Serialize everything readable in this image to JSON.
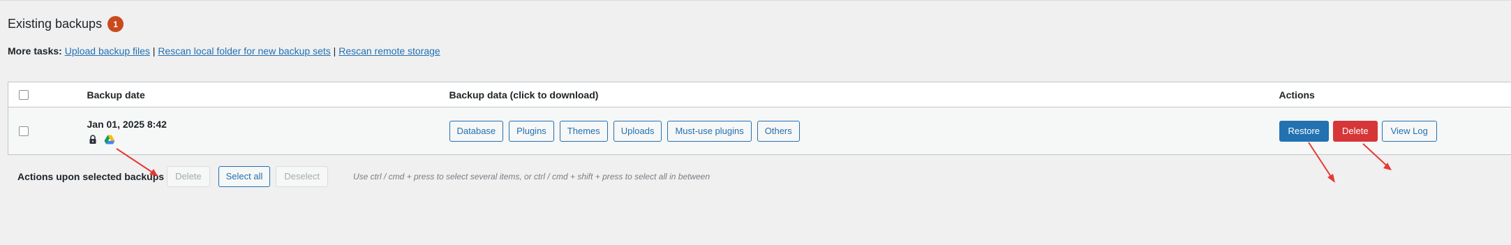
{
  "header": {
    "title": "Existing backups",
    "count_badge": "1"
  },
  "more_tasks": {
    "label": "More tasks:",
    "links": [
      "Upload backup files",
      "Rescan local folder for new backup sets",
      "Rescan remote storage"
    ],
    "separator": "|"
  },
  "table": {
    "columns": [
      "",
      "Backup date",
      "Backup data (click to download)",
      "Actions"
    ],
    "rows": [
      {
        "date": "Jan 01, 2025 8:42",
        "icons": [
          "lock-icon",
          "google-drive-icon"
        ],
        "data_buttons": [
          "Database",
          "Plugins",
          "Themes",
          "Uploads",
          "Must-use plugins",
          "Others"
        ],
        "actions": {
          "restore": "Restore",
          "delete": "Delete",
          "view_log": "View Log"
        }
      }
    ]
  },
  "bulk_actions": {
    "label": "Actions upon selected backups",
    "delete": "Delete",
    "select_all": "Select all",
    "deselect": "Deselect",
    "hint": "Use ctrl / cmd + press to select several items, or ctrl / cmd + shift + press to select all in between"
  },
  "colors": {
    "primary": "#2271b1",
    "danger": "#d63638",
    "badge": "#ca4a1f",
    "annotation_arrow": "#e53935"
  }
}
